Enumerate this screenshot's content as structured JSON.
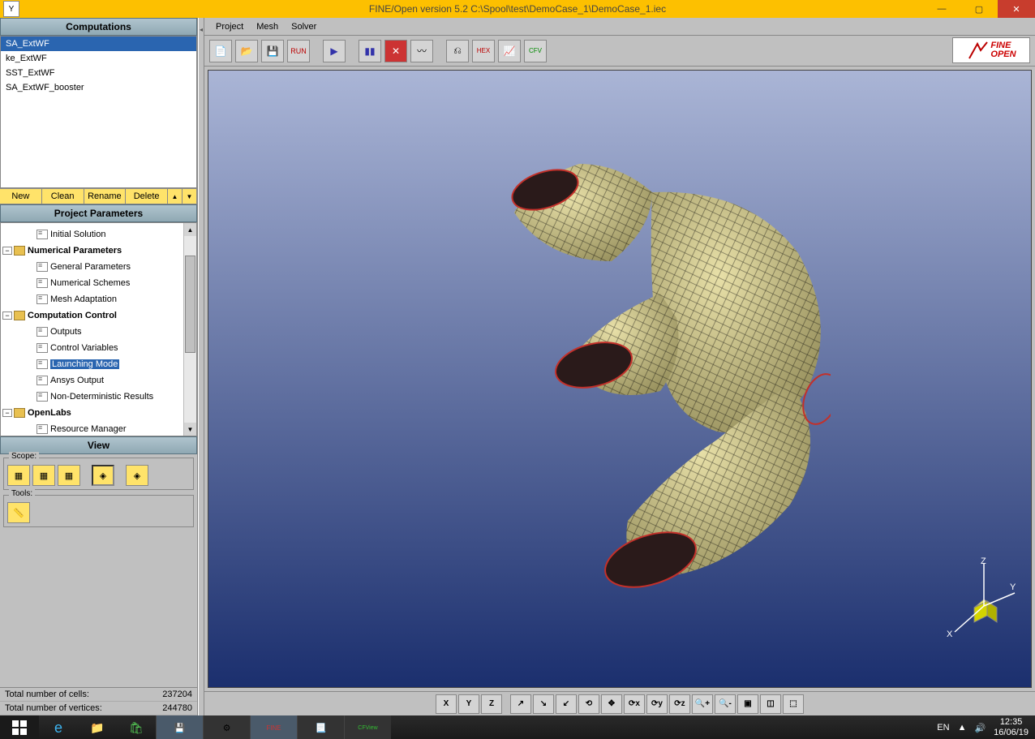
{
  "window": {
    "title": "FINE/Open version 5.2    C:\\Spool\\test\\DemoCase_1\\DemoCase_1.iec",
    "app_icon": "Y"
  },
  "menubar": {
    "items": [
      "Project",
      "Mesh",
      "Solver"
    ]
  },
  "logo": {
    "line1": "FINE",
    "line2": "OPEN"
  },
  "sidebar": {
    "computations": {
      "header": "Computations",
      "items": [
        "SA_ExtWF",
        "ke_ExtWF",
        "SST_ExtWF",
        "SA_ExtWF_booster"
      ],
      "selected": 0,
      "buttons": [
        "New",
        "Clean",
        "Rename",
        "Delete"
      ]
    },
    "project_params": {
      "header": "Project Parameters",
      "nodes": [
        {
          "indent": 2,
          "icon": "page",
          "label": "Initial Solution"
        },
        {
          "indent": 0,
          "expand": "-",
          "icon": "folder",
          "label": "Numerical Parameters",
          "bold": true
        },
        {
          "indent": 2,
          "icon": "page",
          "label": "General Parameters"
        },
        {
          "indent": 2,
          "icon": "page",
          "label": "Numerical Schemes"
        },
        {
          "indent": 2,
          "icon": "page",
          "label": "Mesh Adaptation"
        },
        {
          "indent": 0,
          "expand": "-",
          "icon": "folder",
          "label": "Computation Control",
          "bold": true
        },
        {
          "indent": 2,
          "icon": "page",
          "label": "Outputs"
        },
        {
          "indent": 2,
          "icon": "page",
          "label": "Control Variables"
        },
        {
          "indent": 2,
          "icon": "page",
          "label": "Launching Mode",
          "selected": true
        },
        {
          "indent": 2,
          "icon": "page",
          "label": "Ansys Output"
        },
        {
          "indent": 2,
          "icon": "page",
          "label": "Non-Deterministic Results"
        },
        {
          "indent": 0,
          "expand": "-",
          "icon": "folder",
          "label": "OpenLabs",
          "bold": true
        },
        {
          "indent": 2,
          "icon": "page",
          "label": "Resource Manager"
        }
      ]
    },
    "view": {
      "header": "View",
      "scope_label": "Scope:",
      "tools_label": "Tools:"
    }
  },
  "status": {
    "rows": [
      {
        "label": "Total number of cells:",
        "value": "237204"
      },
      {
        "label": "Total number of vertices:",
        "value": "244780"
      }
    ]
  },
  "bottom_tb": {
    "labels": [
      "X",
      "Y",
      "Z"
    ]
  },
  "axis": {
    "x": "X",
    "y": "Y",
    "z": "Z"
  },
  "tray": {
    "lang": "EN",
    "time": "12:35",
    "date": "16/06/19"
  }
}
